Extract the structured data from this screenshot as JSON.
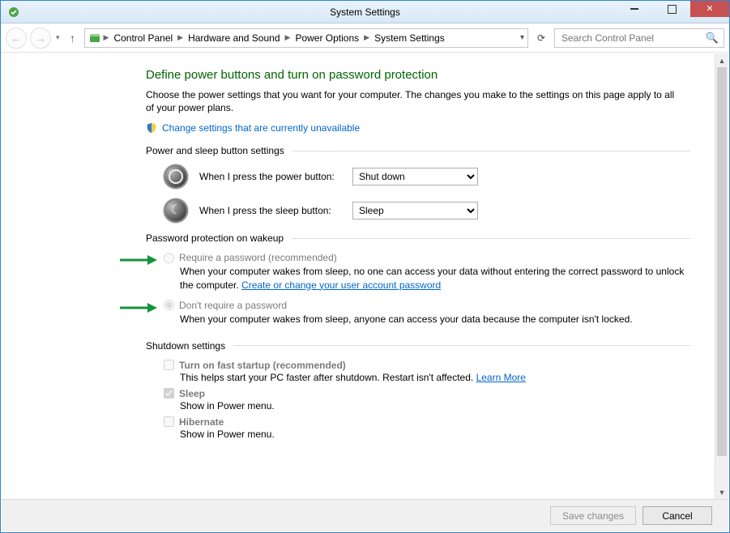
{
  "window": {
    "title": "System Settings"
  },
  "breadcrumb": {
    "items": [
      "Control Panel",
      "Hardware and Sound",
      "Power Options",
      "System Settings"
    ]
  },
  "search": {
    "placeholder": "Search Control Panel"
  },
  "heading": "Define power buttons and turn on password protection",
  "intro": "Choose the power settings that you want for your computer. The changes you make to the settings on this page apply to all of your power plans.",
  "change_link": "Change settings that are currently unavailable",
  "sections": {
    "power_sleep": "Power and sleep button settings",
    "password": "Password protection on wakeup",
    "shutdown": "Shutdown settings"
  },
  "power": {
    "power_btn_label": "When I press the power button:",
    "power_btn_value": "Shut down",
    "sleep_btn_label": "When I press the sleep button:",
    "sleep_btn_value": "Sleep"
  },
  "password_opts": {
    "require": {
      "label": "Require a password (recommended)",
      "desc_a": "When your computer wakes from sleep, no one can access your data without entering the correct password to unlock the computer. ",
      "link": "Create or change your user account password"
    },
    "dont": {
      "label": "Don't require a password",
      "desc": "When your computer wakes from sleep, anyone can access your data because the computer isn't locked."
    }
  },
  "shutdown": {
    "fast": {
      "label": "Turn on fast startup (recommended)",
      "desc": "This helps start your PC faster after shutdown. Restart isn't affected. ",
      "link": "Learn More",
      "checked": false
    },
    "sleep": {
      "label": "Sleep",
      "desc": "Show in Power menu.",
      "checked": true
    },
    "hibernate": {
      "label": "Hibernate",
      "desc": "Show in Power menu.",
      "checked": false
    }
  },
  "footer": {
    "save": "Save changes",
    "cancel": "Cancel"
  }
}
